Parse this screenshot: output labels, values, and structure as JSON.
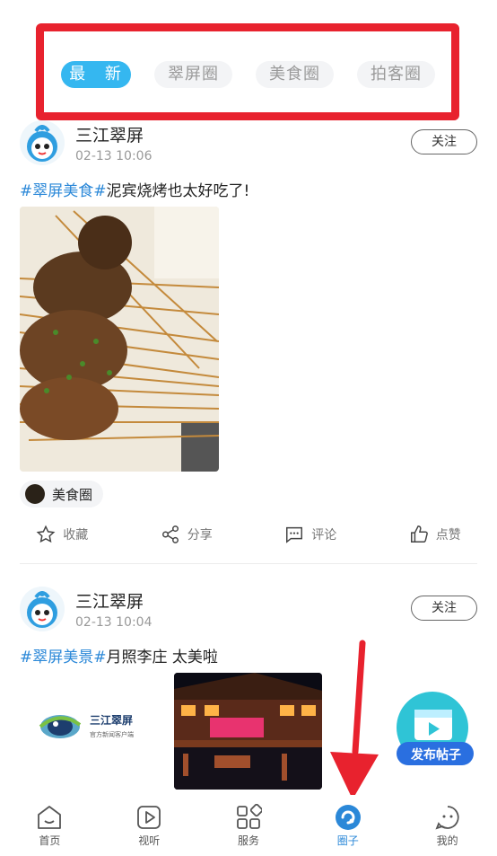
{
  "tabs": [
    {
      "label": "最 新",
      "active": true
    },
    {
      "label": "翠屏圈",
      "active": false
    },
    {
      "label": "美食圈",
      "active": false
    },
    {
      "label": "拍客圈",
      "active": false
    }
  ],
  "posts": [
    {
      "author": "三江翠屏",
      "time": "02-13 10:06",
      "follow_label": "关注",
      "hashtag": "#翠屏美食#",
      "text": "泥宾烧烤也太好吃了!",
      "circle": "美食圈",
      "actions": {
        "collect": "收藏",
        "share": "分享",
        "comment": "评论",
        "like": "点赞"
      }
    },
    {
      "author": "三江翠屏",
      "time": "02-13 10:04",
      "follow_label": "关注",
      "hashtag": "#翠屏美景#",
      "text": "月照李庄 太美啦",
      "logo_text": "三江翠屏",
      "logo_subtext": "官方新闻客户端"
    }
  ],
  "fab": {
    "label": "发布帖子"
  },
  "bottom_nav": [
    {
      "label": "首页",
      "icon": "home-icon",
      "active": false
    },
    {
      "label": "视听",
      "icon": "video-icon",
      "active": false
    },
    {
      "label": "服务",
      "icon": "services-icon",
      "active": false
    },
    {
      "label": "圈子",
      "icon": "circle-icon",
      "active": true
    },
    {
      "label": "我的",
      "icon": "profile-icon",
      "active": false
    }
  ],
  "colors": {
    "accent": "#35b7f0",
    "link": "#2b88d8",
    "highlight": "#e8222e"
  }
}
